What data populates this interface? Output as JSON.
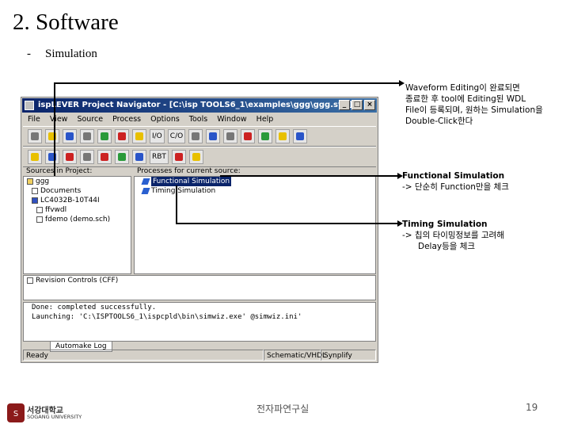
{
  "slide": {
    "title": "2. Software",
    "bullet": "-",
    "subtitle": "Simulation"
  },
  "annotations": {
    "first": [
      "Waveform Editing이 완료되면",
      "종료한 후 tool에 Editing된 WDL",
      "File이 등록되며, 원하는 Simulation을",
      "Double-Click한다"
    ],
    "functional_title": "Functional Simulation",
    "functional_desc": "-> 단순히 Function만을 체크",
    "timing_title": "Timing Simulation",
    "timing_desc1": "-> 칩의 타이밍정보를 고려해",
    "timing_desc2": "Delay등을 체크"
  },
  "window": {
    "title": "ispLEVER Project Navigator - [C:\\isp TOOLS6_1\\examples\\ggg\\ggg.syn]",
    "min": "_",
    "max": "□",
    "close": "×",
    "menu": [
      "File",
      "View",
      "Source",
      "Process",
      "Options",
      "Tools",
      "Window",
      "Help"
    ],
    "toolbar_text": [
      "I/O",
      "C/O"
    ],
    "toolbar2_text": [
      "RBT"
    ],
    "sources_label": "Sources in Project:",
    "sources": [
      {
        "icon": "folder",
        "text": "ggg"
      },
      {
        "icon": "doc",
        "text": "Documents"
      },
      {
        "icon": "chip",
        "text": "LC4032B-10T44I"
      },
      {
        "icon": "doc",
        "text": "ffvwdl"
      },
      {
        "icon": "doc",
        "text": "fdemo (demo.sch)"
      }
    ],
    "processes_label": "Processes for current source:",
    "processes": [
      {
        "text": "Functional Simulation",
        "selected": true
      },
      {
        "text": "Timing Simulation",
        "selected": false
      }
    ],
    "revision_label": "Revision Controls (CFF)",
    "log_lines": [
      "Done: completed successfully.",
      "Launching: 'C:\\ISPTOOLS6_1\\ispcpld\\bin\\simwiz.exe' @simwiz.ini'"
    ],
    "log_tab": "Automake Log",
    "status": [
      "Ready",
      "Schematic/VHDL",
      "Synplify"
    ]
  },
  "footer": {
    "logo_text": "서강대학교",
    "logo_sub": "SOGANG UNIVERSITY",
    "center": "전자파연구실",
    "page": "19"
  }
}
